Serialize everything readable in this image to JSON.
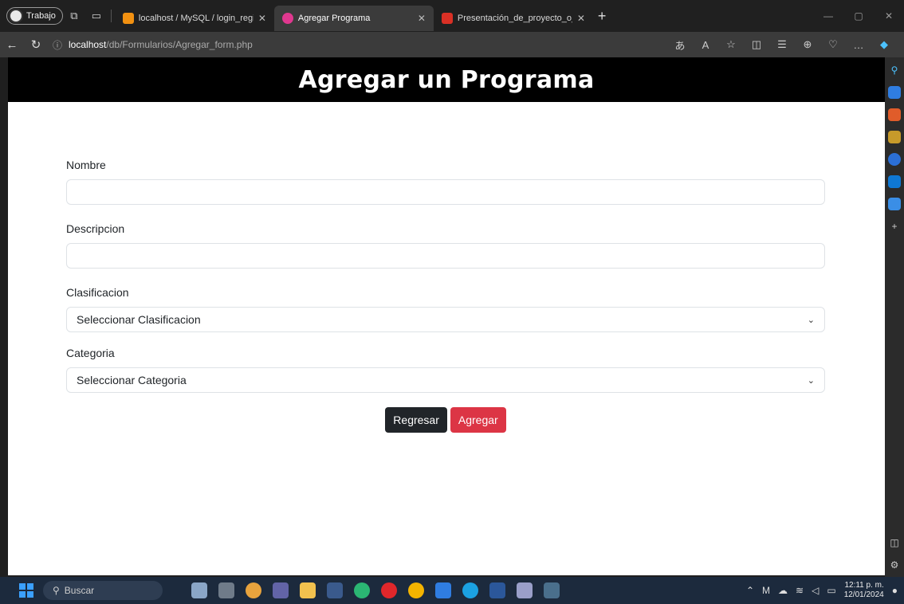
{
  "browser": {
    "profile_label": "Trabajo",
    "tabs": [
      {
        "title": "localhost / MySQL / login_registe",
        "icon": "phpmyadmin-icon",
        "active": false
      },
      {
        "title": "Agregar Programa",
        "icon": "page-icon",
        "active": true
      },
      {
        "title": "Presentación_de_proyecto_o_pr",
        "icon": "pdf-icon",
        "active": false
      }
    ],
    "url_host": "localhost",
    "url_path": "/db/Formularios/Agregar_form.php"
  },
  "page": {
    "title": "Agregar un Programa",
    "form": {
      "nombre_label": "Nombre",
      "nombre_value": "",
      "descripcion_label": "Descripcion",
      "descripcion_value": "",
      "clasificacion_label": "Clasificacion",
      "clasificacion_selected": "Seleccionar Clasificacion",
      "categoria_label": "Categoria",
      "categoria_selected": "Seleccionar Categoria",
      "back_button": "Regresar",
      "submit_button": "Agregar"
    },
    "colors": {
      "header_bg": "#000000",
      "back_button": "#212529",
      "submit_button": "#dc3545"
    }
  },
  "taskbar": {
    "search_label": "Buscar",
    "time": "12:11 p. m.",
    "date": "12/01/2024"
  }
}
